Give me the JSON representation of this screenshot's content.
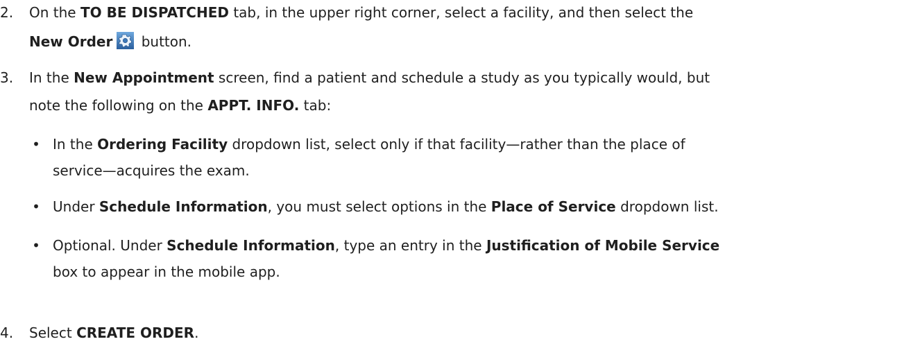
{
  "steps": [
    {
      "number": "2.",
      "segments": [
        {
          "t": "On the "
        },
        {
          "b": "TO BE DISPATCHED"
        },
        {
          "t": " tab, in the upper right corner, select a facility, and then select the"
        },
        {
          "t": "New Order",
          "bold": true
        },
        {
          "icon": "gear-settings-icon"
        },
        {
          "t": " button."
        }
      ]
    },
    {
      "number": "3.",
      "segments": [
        {
          "t": "In the "
        },
        {
          "b": "New Appointment"
        },
        {
          "t": " screen, find a patient and schedule a study as you typically would, but"
        },
        {
          "t": "note the following on the "
        },
        {
          "b": "APPT. INFO."
        },
        {
          "t": " tab:"
        }
      ]
    },
    {
      "number": "4.",
      "segments": [
        {
          "t": "Select "
        },
        {
          "b": "CREATE ORDER"
        },
        {
          "t": "."
        }
      ]
    }
  ],
  "step2": {
    "number": "2.",
    "l1_a": "On the ",
    "l1_b": "TO BE DISPATCHED",
    "l1_c": " tab, in the upper right corner, select a facility, and then select the",
    "l2_b": "New Order",
    "l2_c": " button."
  },
  "step3": {
    "number": "3.",
    "l1_a": "In the ",
    "l1_b": "New Appointment",
    "l1_c": " screen, find a patient and schedule a study as you typically would, but",
    "l2_a": "note the following on the ",
    "l2_b": "APPT. INFO.",
    "l2_c": " tab:",
    "bullets": [
      {
        "l1_a": "In the ",
        "l1_b": "Ordering Facility",
        "l1_c": " dropdown list, select only if that facility—rather than the place of",
        "l2_a": "service—acquires the exam."
      },
      {
        "l1_a": "Under ",
        "l1_b": "Schedule Information",
        "l1_c": ", you must select options in the ",
        "l1_d": "Place of Service",
        "l1_e": " dropdown list."
      },
      {
        "l1_a": "Optional. Under ",
        "l1_b": "Schedule Information",
        "l1_c": ", type an entry in the ",
        "l1_d": "Justification of Mobile Service",
        "l2_a": "box to appear in the mobile app."
      }
    ]
  },
  "step4": {
    "number": "4.",
    "l1_a": "Select ",
    "l1_b": "CREATE ORDER",
    "l1_c": "."
  },
  "bullet_char": "•",
  "icons": {
    "new_order": "gear-settings-icon"
  },
  "colors": {
    "text": "#1f1f1f",
    "icon_blue": "#2f6fb3"
  }
}
